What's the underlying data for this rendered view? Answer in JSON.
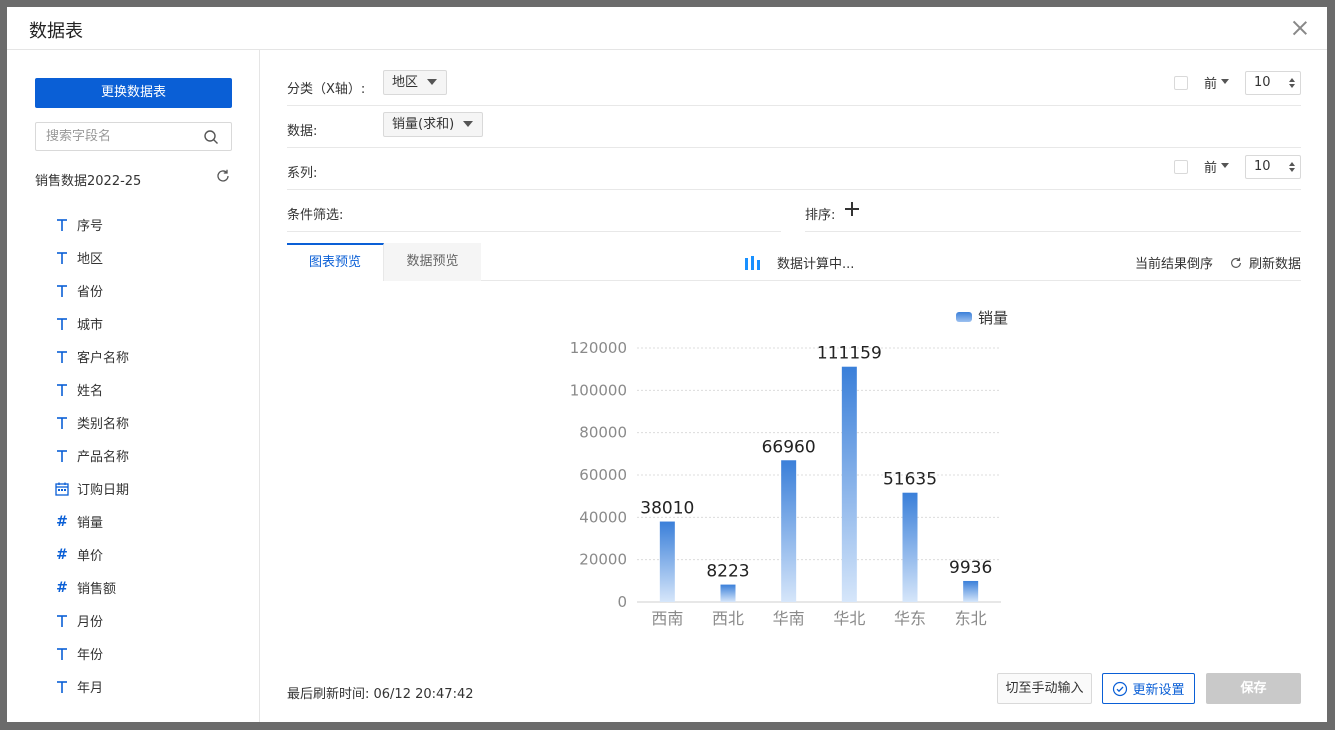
{
  "dialog": {
    "title": "数据表"
  },
  "sidebar": {
    "change_button": "更换数据表",
    "search_placeholder": "搜索字段名",
    "dataset_name": "销售数据2022-25",
    "fields": [
      {
        "label": "序号",
        "icon": "text-type-icon"
      },
      {
        "label": "地区",
        "icon": "text-type-icon"
      },
      {
        "label": "省份",
        "icon": "text-type-icon"
      },
      {
        "label": "城市",
        "icon": "text-type-icon"
      },
      {
        "label": "客户名称",
        "icon": "text-type-icon"
      },
      {
        "label": "姓名",
        "icon": "text-type-icon"
      },
      {
        "label": "类别名称",
        "icon": "text-type-icon"
      },
      {
        "label": "产品名称",
        "icon": "text-type-icon"
      },
      {
        "label": "订购日期",
        "icon": "calendar-icon"
      },
      {
        "label": "销量",
        "icon": "number-type-icon"
      },
      {
        "label": "单价",
        "icon": "number-type-icon"
      },
      {
        "label": "销售额",
        "icon": "number-type-icon"
      },
      {
        "label": "月份",
        "icon": "text-type-icon"
      },
      {
        "label": "年份",
        "icon": "text-type-icon"
      },
      {
        "label": "年月",
        "icon": "text-type-icon"
      }
    ]
  },
  "config": {
    "category_label": "分类（X轴）:",
    "category_value": "地区",
    "data_label": "数据:",
    "data_value": "销量(求和)",
    "series_label": "系列:",
    "filter_label": "条件筛选:",
    "sort_label": "排序:",
    "top_label": "前",
    "top_value_category": "10",
    "top_value_series": "10"
  },
  "tabs": {
    "chart_preview": "图表预览",
    "data_preview": "数据预览",
    "calculating": "数据计算中...",
    "reverse": "当前结果倒序",
    "refresh": "刷新数据"
  },
  "footer": {
    "last_refresh": "最后刷新时间: 06/12 20:47:42",
    "manual_input": "切至手动输入",
    "update_settings": "更新设置",
    "save": "保存"
  },
  "colors": {
    "accent": "#0a5fd6",
    "bar_top": "#3a7fd9",
    "bar_bottom": "#d6e6fa"
  },
  "chart_data": {
    "type": "bar",
    "categories": [
      "西南",
      "西北",
      "华南",
      "华北",
      "华东",
      "东北"
    ],
    "series": [
      {
        "name": "销量",
        "values": [
          38010,
          8223,
          66960,
          111159,
          51635,
          9936
        ]
      }
    ],
    "ylim": [
      0,
      120000
    ],
    "yticks": [
      0,
      20000,
      40000,
      60000,
      80000,
      100000,
      120000
    ],
    "legend": "top-right",
    "grid": true
  }
}
